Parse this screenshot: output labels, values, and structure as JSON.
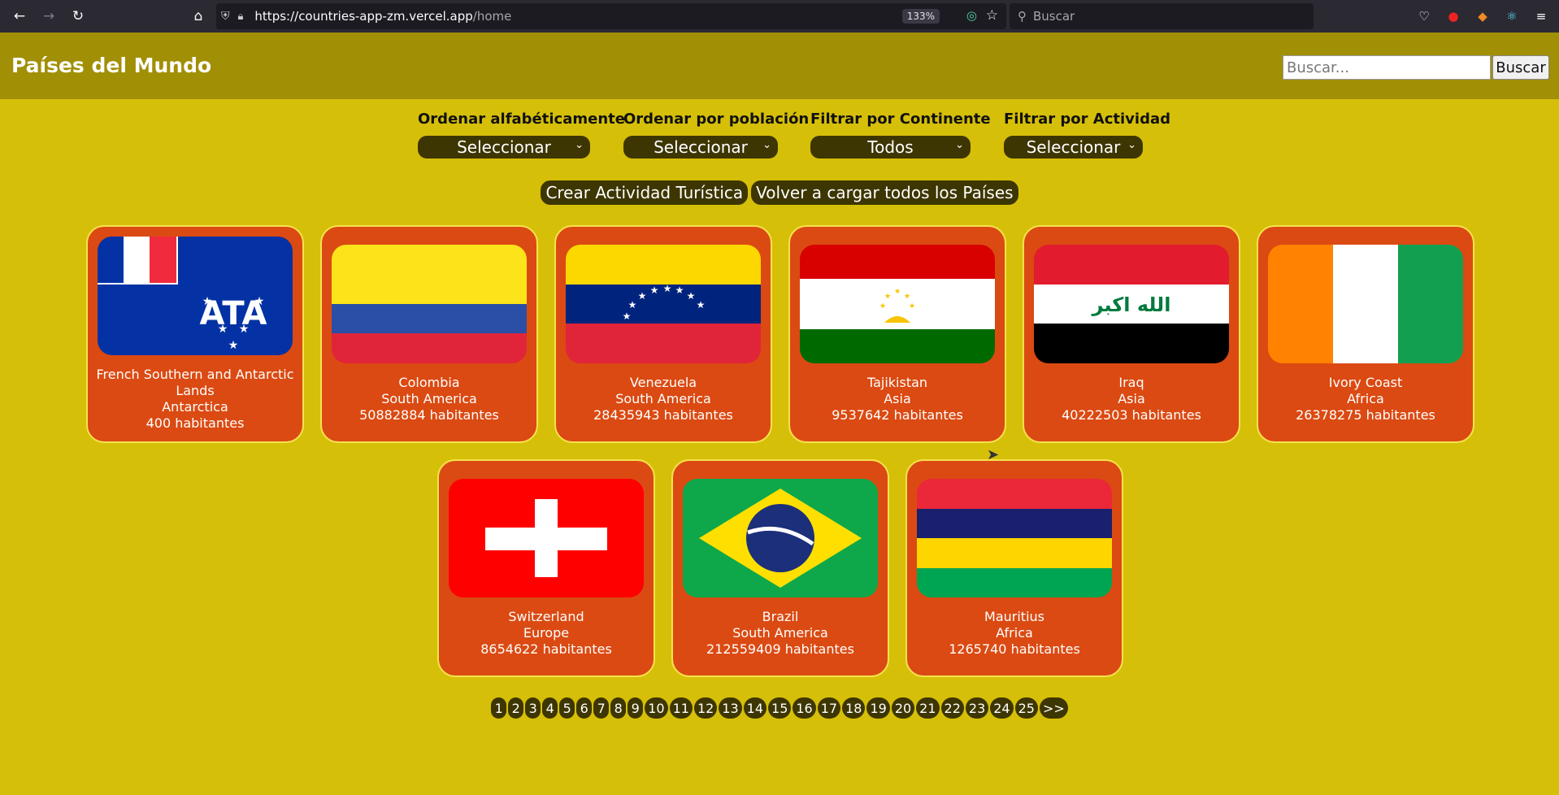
{
  "browser": {
    "url_host": "https://countries-app-zm.vercel.app",
    "url_path": "/home",
    "zoom": "133%",
    "search_placeholder": "Buscar"
  },
  "header": {
    "title": "Países del Mundo",
    "search_placeholder": "Buscar...",
    "search_button": "Buscar"
  },
  "filters": [
    {
      "label": "Ordenar alfabéticamente",
      "value": "Seleccionar"
    },
    {
      "label": "Ordenar por población",
      "value": "Seleccionar"
    },
    {
      "label": "Filtrar por Continente",
      "value": "Todos"
    },
    {
      "label": "Filtrar por Actividad",
      "value": "Seleccionar"
    }
  ],
  "actions": {
    "create_activity": "Crear Actividad Turística",
    "reload_countries": "Volver a cargar todos los Países"
  },
  "countries": [
    {
      "name": "French Southern and Antarctic Lands",
      "continent": "Antarctica",
      "population": "400 habitantes",
      "flag": "atf-flag"
    },
    {
      "name": "Colombia",
      "continent": "South America",
      "population": "50882884 habitantes",
      "flag": "col-flag"
    },
    {
      "name": "Venezuela",
      "continent": "South America",
      "population": "28435943 habitantes",
      "flag": "ven-flag"
    },
    {
      "name": "Tajikistan",
      "continent": "Asia",
      "population": "9537642 habitantes",
      "flag": "tjk-flag"
    },
    {
      "name": "Iraq",
      "continent": "Asia",
      "population": "40222503 habitantes",
      "flag": "irq-flag"
    },
    {
      "name": "Ivory Coast",
      "continent": "Africa",
      "population": "26378275 habitantes",
      "flag": "civ-flag"
    },
    {
      "name": "Switzerland",
      "continent": "Europe",
      "population": "8654622 habitantes",
      "flag": "che-flag"
    },
    {
      "name": "Brazil",
      "continent": "South America",
      "population": "212559409 habitantes",
      "flag": "bra-flag"
    },
    {
      "name": "Mauritius",
      "continent": "Africa",
      "population": "1265740 habitantes",
      "flag": "mus-flag"
    }
  ],
  "flag_texts": {
    "irq": "الله اكبر"
  },
  "pagination": [
    "1",
    "2",
    "3",
    "4",
    "5",
    "6",
    "7",
    "8",
    "9",
    "10",
    "11",
    "12",
    "13",
    "14",
    "15",
    "16",
    "17",
    "18",
    "19",
    "20",
    "21",
    "22",
    "23",
    "24",
    "25",
    ">>"
  ]
}
